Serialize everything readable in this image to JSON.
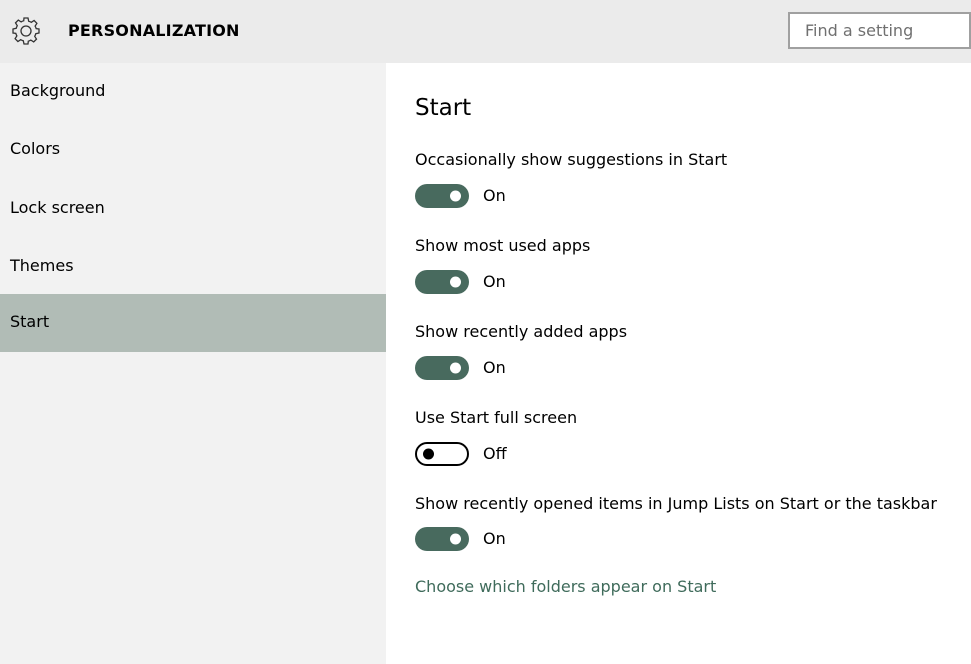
{
  "header": {
    "icon": "gear-icon",
    "title": "PERSONALIZATION",
    "search_placeholder": "Find a setting"
  },
  "sidebar": {
    "items": [
      {
        "label": "Background",
        "selected": false
      },
      {
        "label": "Colors",
        "selected": false
      },
      {
        "label": "Lock screen",
        "selected": false
      },
      {
        "label": "Themes",
        "selected": false
      },
      {
        "label": "Start",
        "selected": true
      }
    ]
  },
  "main": {
    "heading": "Start",
    "settings": [
      {
        "label": "Occasionally show suggestions in Start",
        "state": "On"
      },
      {
        "label": "Show most used apps",
        "state": "On"
      },
      {
        "label": "Show recently added apps",
        "state": "On"
      },
      {
        "label": "Use Start full screen",
        "state": "Off"
      },
      {
        "label": "Show recently opened items in Jump Lists on Start or the taskbar",
        "state": "On"
      }
    ],
    "link": "Choose which folders appear on Start"
  },
  "colors": {
    "accent": "#486a5e",
    "selected_nav": "#b1bcb6",
    "link": "#3f6b5b"
  }
}
